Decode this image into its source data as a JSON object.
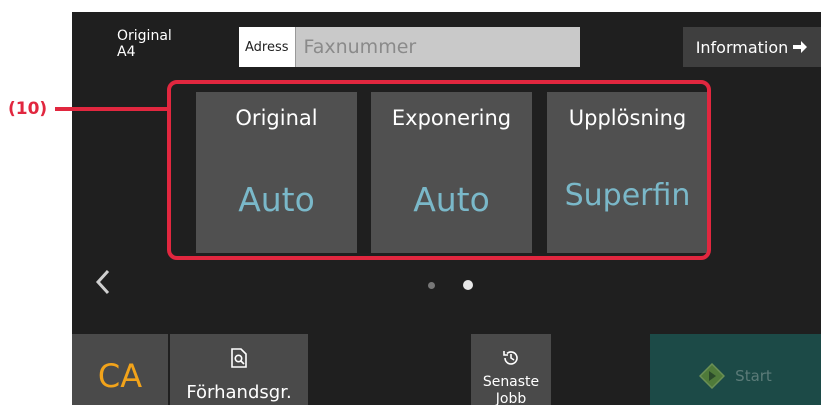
{
  "header": {
    "original_label": "Original",
    "original_size": "A4",
    "address_label": "Adress",
    "address_placeholder": "Faxnummer",
    "information_label": "Information"
  },
  "tiles": [
    {
      "label": "Original",
      "value": "Auto"
    },
    {
      "label": "Exponering",
      "value": "Auto"
    },
    {
      "label": "Upplösning",
      "value": "Superfin"
    }
  ],
  "callout": {
    "label": "(10)",
    "color": "#e1273f"
  },
  "pager": {
    "active_page": 2,
    "page_count": 2
  },
  "bottom_bar": {
    "ca_label": "CA",
    "preview_label": "Förhandsgr.",
    "recent_label_line1": "Senaste",
    "recent_label_line2": "Jobb",
    "start_label": "Start"
  },
  "icons": {
    "info": "arrow-right-icon",
    "prev": "chevron-left-icon",
    "preview": "preview-icon",
    "recent": "history-icon",
    "start": "start-diamond-icon"
  },
  "colors": {
    "accent": "#7ab8c9",
    "ca": "#f2a31a",
    "start_bg": "#1c4a47"
  }
}
